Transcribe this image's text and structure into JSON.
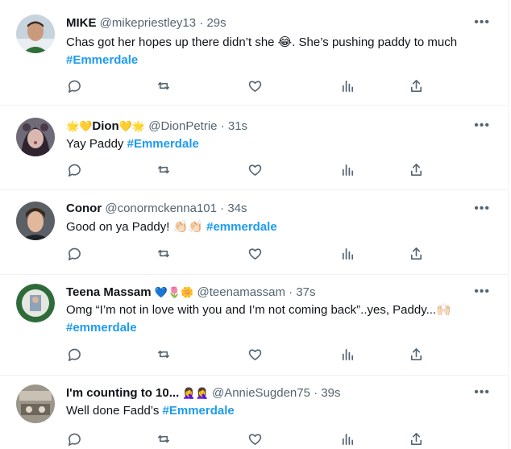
{
  "tweets": [
    {
      "name": "MIKE",
      "name_prefix": "",
      "name_suffix": "",
      "handle": "@mikepriestley13",
      "time": "29s",
      "text": "Chas got her hopes up there didn’t she 😂. She’s pushing paddy to much",
      "hashtag": "#Emmerdale",
      "avatar": "man-selfie-avatar"
    },
    {
      "name": "Dion",
      "name_prefix": "🌟💛",
      "name_suffix": "💛🌟",
      "handle": "@DionPetrie",
      "time": "31s",
      "text": "Yay Paddy",
      "hashtag": "#Emmerdale",
      "avatar": "filter-face-avatar"
    },
    {
      "name": "Conor",
      "name_prefix": "",
      "name_suffix": "",
      "handle": "@conormckenna101",
      "time": "34s",
      "text": "Good on ya Paddy! 👏🏻👏🏻",
      "hashtag": "#emmerdale",
      "avatar": "young-man-avatar"
    },
    {
      "name": "Teena Massam",
      "name_prefix": "",
      "name_suffix": "💙🌷🌼",
      "handle": "@teenamassam",
      "time": "37s",
      "text": "Omg “I’m not in love with you and I’m not coming back”..yes, Paddy...🙌🏻",
      "hashtag": "#emmerdale",
      "avatar": "green-badge-avatar"
    },
    {
      "name": "I'm counting to 10...",
      "name_prefix": "",
      "name_suffix": "🤦‍♀️🤦‍♀️",
      "handle": "@AnnieSugden75",
      "time": "39s",
      "text": "Well done Fadd’s",
      "hashtag": "#Emmerdale",
      "avatar": "blurry-photo-avatar"
    }
  ],
  "more_label": "•••",
  "separator": "·",
  "colors": {
    "link": "#1d9bf0",
    "secondary": "#536471",
    "divider": "#eff3f4"
  },
  "action_icons": [
    "reply-icon",
    "retweet-icon",
    "like-icon",
    "views-icon",
    "share-icon"
  ]
}
